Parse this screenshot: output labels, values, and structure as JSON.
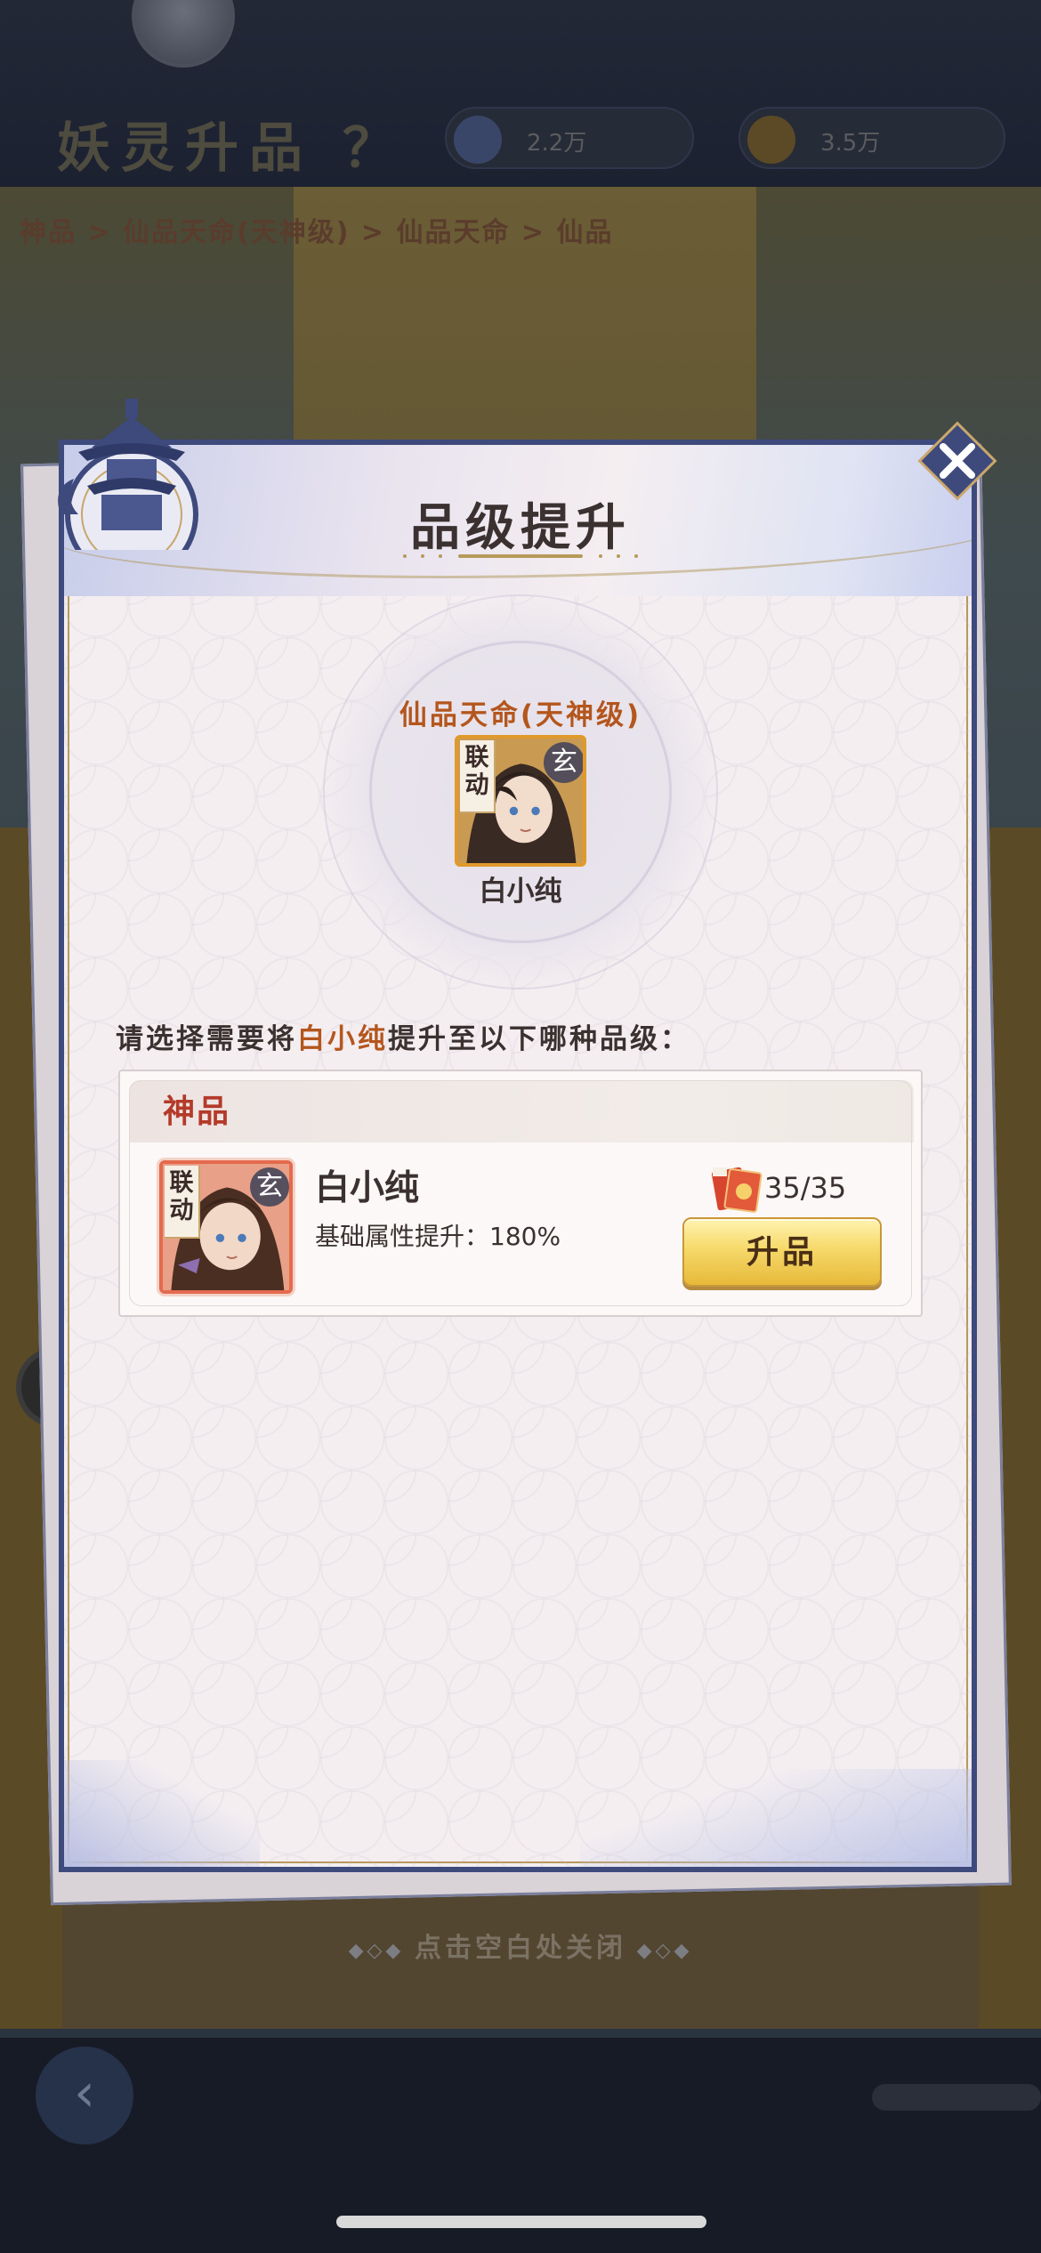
{
  "dialog": {
    "title": "品级提升",
    "current": {
      "grade": "仙品天命(天神级)",
      "hero_name": "白小纯",
      "tag": "联动",
      "element": "玄"
    },
    "prompt": {
      "before": "请选择需要将",
      "hero": "白小纯",
      "after": "提升至以下哪种品级："
    },
    "options": [
      {
        "grade": "神品",
        "hero_name": "白小纯",
        "tag": "联动",
        "element": "玄",
        "bonus": "基础属性提升：180%",
        "cost": "35/35",
        "button": "升品"
      }
    ],
    "close_hint": "点击空白处关闭"
  },
  "background": {
    "title": "妖灵升品 ？",
    "currency_1": "2.2万",
    "currency_2": "3.5万",
    "breadcrumb": "神品 > 仙品天命(天神级) > 仙品天命 > 仙品",
    "back_glyph": "‹"
  },
  "colors": {
    "accent_orange": "#b4561d",
    "grade_red": "#b43a2a",
    "dialog_border": "#3e4a7c",
    "button_gold": "#f6d96a"
  }
}
